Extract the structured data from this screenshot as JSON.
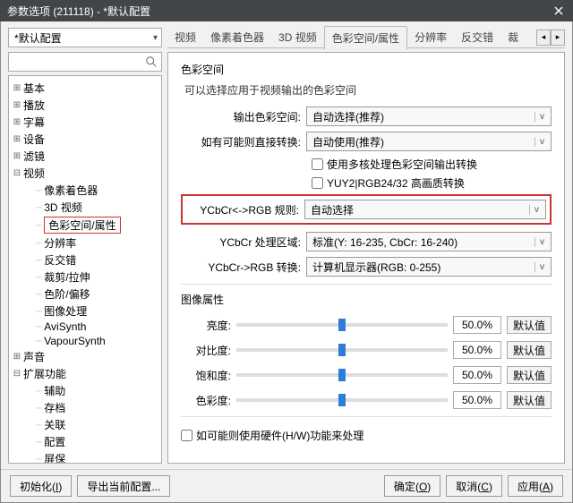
{
  "window": {
    "title": "参数选项 (211118) - *默认配置"
  },
  "config_dropdown": {
    "value": "*默认配置"
  },
  "tabs": {
    "items": [
      "视频",
      "像素着色器",
      "3D 视频",
      "色彩空间/属性",
      "分辨率",
      "反交错",
      "裁"
    ],
    "active_index": 3
  },
  "tree": {
    "items": [
      {
        "label": "基本",
        "exp": "+",
        "level": 0
      },
      {
        "label": "播放",
        "exp": "+",
        "level": 0
      },
      {
        "label": "字幕",
        "exp": "+",
        "level": 0
      },
      {
        "label": "设备",
        "exp": "+",
        "level": 0
      },
      {
        "label": "滤镜",
        "exp": "+",
        "level": 0
      },
      {
        "label": "视频",
        "exp": "-",
        "level": 0
      },
      {
        "label": "像素着色器",
        "level": 1
      },
      {
        "label": "3D 视频",
        "level": 1
      },
      {
        "label": "色彩空间/属性",
        "level": 1,
        "selected": true
      },
      {
        "label": "分辨率",
        "level": 1
      },
      {
        "label": "反交错",
        "level": 1
      },
      {
        "label": "裁剪/拉伸",
        "level": 1
      },
      {
        "label": "色阶/偏移",
        "level": 1
      },
      {
        "label": "图像处理",
        "level": 1
      },
      {
        "label": "AviSynth",
        "level": 1
      },
      {
        "label": "VapourSynth",
        "level": 1
      },
      {
        "label": "声音",
        "exp": "+",
        "level": 0
      },
      {
        "label": "扩展功能",
        "exp": "-",
        "level": 0
      },
      {
        "label": "辅助",
        "level": 1
      },
      {
        "label": "存档",
        "level": 1
      },
      {
        "label": "关联",
        "level": 1
      },
      {
        "label": "配置",
        "level": 1
      },
      {
        "label": "屏保",
        "level": 1
      }
    ]
  },
  "content": {
    "group1_title": "色彩空间",
    "group1_desc": "可以选择应用于视频输出的色彩空间",
    "output_cs_label": "输出色彩空间:",
    "output_cs_value": "自动选择(推荐)",
    "direct_conv_label": "如有可能则直接转换:",
    "direct_conv_value": "自动使用(推荐)",
    "cb_multicore": "使用多核处理色彩空间输出转换",
    "cb_yuy2": "YUY2|RGB24/32 高画质转换",
    "rule_label": "YCbCr<->RGB 规则:",
    "rule_value": "自动选择",
    "proc_range_label": "YCbCr 处理区域:",
    "proc_range_value": "标准(Y: 16-235, CbCr: 16-240)",
    "rgb_conv_label": "YCbCr->RGB 转换:",
    "rgb_conv_value": "计算机显示器(RGB: 0-255)",
    "group2_title": "图像属性",
    "sliders": [
      {
        "label": "亮度:",
        "value": "50.0%"
      },
      {
        "label": "对比度:",
        "value": "50.0%"
      },
      {
        "label": "饱和度:",
        "value": "50.0%"
      },
      {
        "label": "色彩度:",
        "value": "50.0%"
      }
    ],
    "default_btn": "默认值",
    "hw_checkbox": "如可能则使用硬件(H/W)功能来处理"
  },
  "footer": {
    "init": "初始化",
    "export": "导出当前配置...",
    "ok": "确定",
    "cancel": "取消",
    "apply": "应用"
  }
}
